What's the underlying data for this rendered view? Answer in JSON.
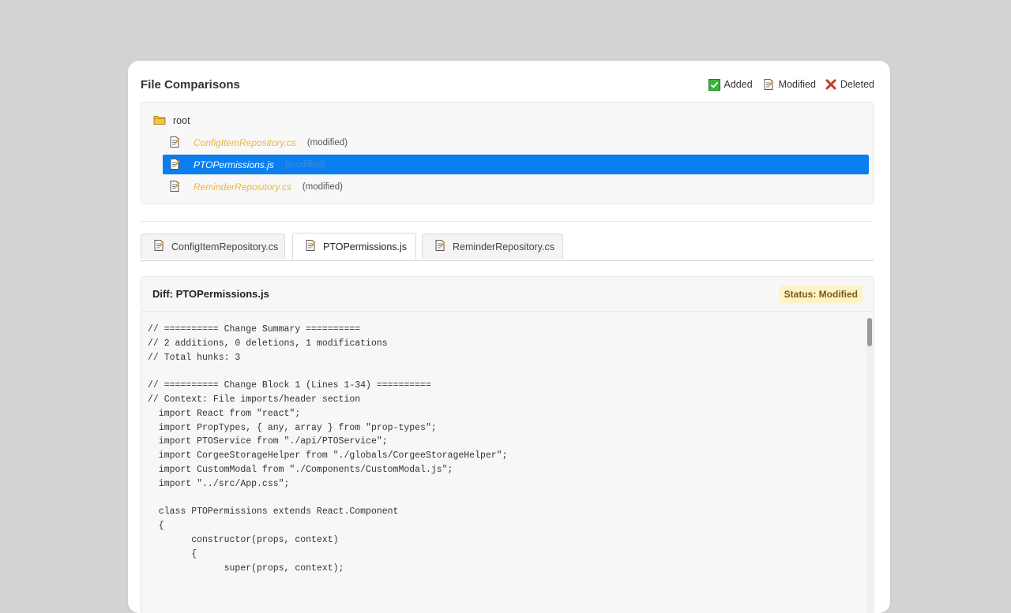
{
  "header": {
    "title": "File Comparisons",
    "legend": {
      "added": "Added",
      "modified": "Modified",
      "deleted": "Deleted"
    }
  },
  "tree": {
    "root_label": "root",
    "files": [
      {
        "name": "ConfigItemRepository.cs",
        "status": "(modified)"
      },
      {
        "name": "PTOPermissions.js",
        "status": "(modified)",
        "selected": true
      },
      {
        "name": "ReminderRepository.cs",
        "status": "(modified)"
      }
    ]
  },
  "tabs": [
    {
      "label": "ConfigItemRepository.cs"
    },
    {
      "label": "PTOPermissions.js",
      "active": true
    },
    {
      "label": "ReminderRepository.cs"
    }
  ],
  "diff": {
    "title": "Diff: PTOPermissions.js",
    "status": "Status: Modified",
    "code": "// ========== Change Summary ==========\n// 2 additions, 0 deletions, 1 modifications\n// Total hunks: 3\n\n// ========== Change Block 1 (Lines 1-34) ==========\n// Context: File imports/header section\n  import React from \"react\";\n  import PropTypes, { any, array } from \"prop-types\";\n  import PTOService from \"./api/PTOService\";\n  import CorgeeStorageHelper from \"./globals/CorgeeStorageHelper\";\n  import CustomModal from \"./Components/CustomModal.js\";\n  import \"../src/App.css\";\n\n  class PTOPermissions extends React.Component\n  {\n        constructor(props, context)\n        {\n              super(props, context);"
  },
  "colors": {
    "selected_row": "#0b7ff0",
    "modified_file_name": "#f0b43c",
    "added_icon": "#3cb33c",
    "deleted_icon": "#c0392b",
    "status_badge_bg": "#fdf3c8"
  }
}
